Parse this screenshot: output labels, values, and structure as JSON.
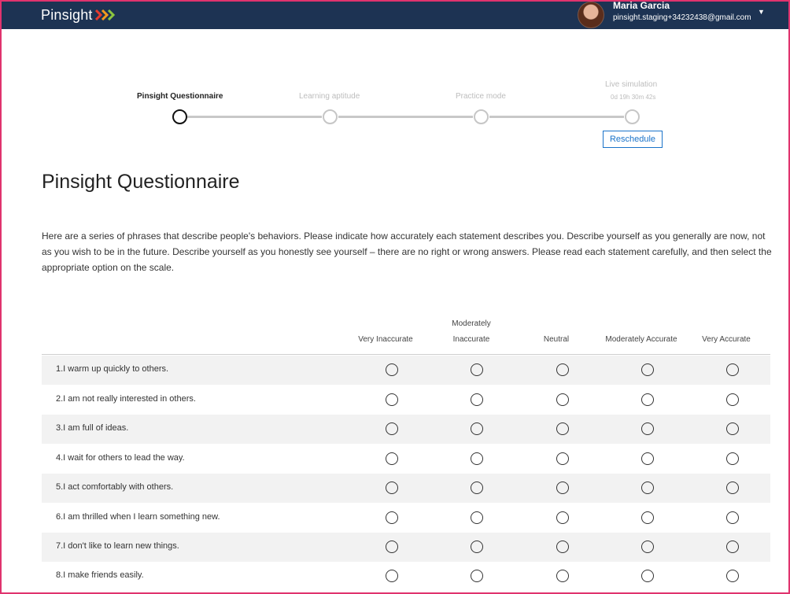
{
  "header": {
    "logo_text": "Pinsight",
    "user_name": "Maria Garcia",
    "user_email": "pinsight.staging+34232438@gmail.com",
    "brand_colors": {
      "bar": "#1d3353",
      "chevron_1": "#e63a2e",
      "chevron_2": "#f29a1e",
      "chevron_3": "#8cc63f"
    }
  },
  "stepper": {
    "steps": [
      {
        "label": "Pinsight Questionnaire",
        "active": true
      },
      {
        "label": "Learning aptitude",
        "active": false
      },
      {
        "label": "Practice mode",
        "active": false
      },
      {
        "label": "Live simulation",
        "active": false,
        "timer": "0d 19h 30m 42s"
      }
    ],
    "reschedule_label": "Reschedule"
  },
  "main": {
    "title": "Pinsight Questionnaire",
    "intro": "Here are a series of phrases that describe people's behaviors. Please indicate how accurately each statement describes you. Describe yourself as you generally are now, not as you wish to be in the future. Describe yourself as you honestly see yourself – there are no right or wrong answers. Please read each statement carefully, and then select the appropriate option on the scale."
  },
  "scale": {
    "columns": [
      {
        "line1": "",
        "line2": "Very Inaccurate"
      },
      {
        "line1": "Moderately",
        "line2": "Inaccurate"
      },
      {
        "line1": "",
        "line2": "Neutral"
      },
      {
        "line1": "",
        "line2": "Moderately Accurate"
      },
      {
        "line1": "",
        "line2": "Very Accurate"
      }
    ]
  },
  "questions": [
    "1.I warm up quickly to others.",
    "2.I am not really interested in others.",
    "3.I am full of ideas.",
    "4.I wait for others to lead the way.",
    "5.I act comfortably with others.",
    "6.I am thrilled when I learn something new.",
    "7.I don't like to learn new things.",
    "8.I make friends easily."
  ]
}
